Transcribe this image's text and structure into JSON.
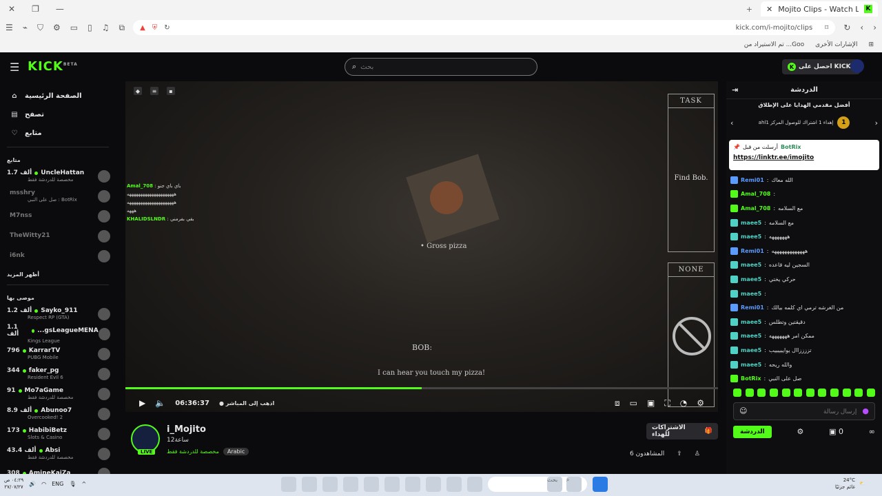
{
  "browser": {
    "tab_title": "Mojito Clips - Watch Live on Kick",
    "url": "kick.com/i-mojito/clips",
    "bookmarks": [
      "الإشارات الأخرى",
      "تم الاستيراد من ...Goo"
    ]
  },
  "header": {
    "logo": "KICK",
    "logo_sup": "BETA",
    "search_placeholder": "بحث",
    "get_kicks": "احصل على KICKs"
  },
  "sidebar": {
    "nav": [
      "الصفحة الرئيسية",
      "تصفح",
      "متابع"
    ],
    "following_title": "متابع",
    "following": [
      {
        "name": "UncleHattan",
        "viewers": "1.7 ألف",
        "sub": "مخصصة للدردشة فقط",
        "live": true
      },
      {
        "name": "msshry",
        "viewers": "",
        "sub": "صل على النبي : BotRix",
        "live": false
      },
      {
        "name": "M7nss",
        "viewers": "",
        "sub": "",
        "live": false
      },
      {
        "name": "TheWitty21",
        "viewers": "",
        "sub": "",
        "live": false
      },
      {
        "name": "i6nk",
        "viewers": "",
        "sub": "",
        "live": false
      }
    ],
    "show_more": "أظهر المزيد",
    "recommended_title": "موصى بها",
    "recommended": [
      {
        "name": "Sayko_911",
        "viewers": "1.2 ألف",
        "sub": "Respect RP (GTA)"
      },
      {
        "name": "...gsLeagueMENA",
        "viewers": "1.1 ألف",
        "sub": "Kings League"
      },
      {
        "name": "KarrarTV",
        "viewers": "796",
        "sub": "PUBG Mobile"
      },
      {
        "name": "faker_pg",
        "viewers": "344",
        "sub": "Resident Evil 6"
      },
      {
        "name": "Mo7aGame",
        "viewers": "91",
        "sub": "مخصصة للدردشة فقط"
      },
      {
        "name": "Abunoo7",
        "viewers": "8.9 ألف",
        "sub": "Overcooked! 2"
      },
      {
        "name": "HabibiBetz",
        "viewers": "173",
        "sub": "Slots & Casino"
      },
      {
        "name": "Absi",
        "viewers": "43.4 ألف",
        "sub": "مخصصة للدردشة فقط"
      },
      {
        "name": "AmineKaiZa",
        "viewers": "308",
        "sub": ""
      }
    ]
  },
  "player": {
    "overlay_chat": [
      {
        "user": "Amal_708",
        "text": "باي باي جنو"
      },
      {
        "user": "",
        "text": "هههههههههههههههههههههه"
      },
      {
        "user": "",
        "text": "هههههههههههههههههههههه"
      },
      {
        "user": "",
        "text": "هههه"
      },
      {
        "user": "KHALIDSLNDR",
        "text": "بقي بفرمني"
      }
    ],
    "game_item": "Gross pizza",
    "speaker": "BOB:",
    "subtitle": "I can hear you touch my pizza!",
    "task_label": "TASK",
    "task_text": "Find Bob.",
    "none_label": "NONE",
    "time": "06:36:37",
    "go_live": "اذهب إلى المباشر",
    "progress": 0.5
  },
  "channel": {
    "name": "i_Mojito",
    "time": "12ساعة",
    "category": "مخصصة للدردشة فقط",
    "language": "Arabic",
    "live": "LIVE",
    "gift_subs": "الاشتراكات للهداء",
    "viewers": "المشاهدون 6"
  },
  "chat": {
    "title": "الدردشة",
    "top_gifters": "أفضل مقدمي الهدايا على الإطلاق",
    "gift_info": "ahlإهداء 1 اشتراك للوصول المركز 1",
    "gift_rank": "1",
    "pinned_by": "أرسلت من قبل",
    "pinned_user": "BotRix",
    "pinned_link": "https://linktr.ee/imojito",
    "messages": [
      {
        "user": "Remi01",
        "text": "الله معاك",
        "color": "#5b9bff"
      },
      {
        "user": "Amal_708",
        "text": "",
        "color": "#53fc18"
      },
      {
        "user": "Amal_708",
        "text": "مع السلامه",
        "color": "#53fc18"
      },
      {
        "user": "maee5",
        "text": "مع السلامه",
        "color": "#4fd1c5"
      },
      {
        "user": "maee5",
        "text": "هههههههه",
        "color": "#4fd1c5"
      },
      {
        "user": "Remi01",
        "text": "هههههههههههههه",
        "color": "#5b9bff"
      },
      {
        "user": "maee5",
        "text": "السجين ليه قاعده",
        "color": "#4fd1c5"
      },
      {
        "user": "maee5",
        "text": "حركي يختي",
        "color": "#4fd1c5"
      },
      {
        "user": "maee5",
        "text": "",
        "color": "#4fd1c5"
      },
      {
        "user": "Remi01",
        "text": "من الغرشه ترمي اي كلمه بيالك",
        "color": "#5b9bff"
      },
      {
        "user": "maee5",
        "text": "دقيقتين وتطلس",
        "color": "#4fd1c5"
      },
      {
        "user": "maee5",
        "text": "ممكن امر هههههههه",
        "color": "#4fd1c5"
      },
      {
        "user": "maee5",
        "text": "تززززاال يواييييييب",
        "color": "#4fd1c5"
      },
      {
        "user": "maee5",
        "text": "والله ريحه",
        "color": "#4fd1c5"
      },
      {
        "user": "BotRix",
        "text": "صل على النبي",
        "color": "#53fc18"
      }
    ],
    "input_placeholder": "إرسال رسالة",
    "kicks_count": "0",
    "chat_button": "الدردشة"
  },
  "taskbar": {
    "time": "٠٤:٢٩ ص",
    "date": "٢٧/٠٧/٢٧",
    "lang": "ENG",
    "search": "بحث",
    "weather_temp": "24°C",
    "weather_desc": "غائم جزئيًا"
  }
}
